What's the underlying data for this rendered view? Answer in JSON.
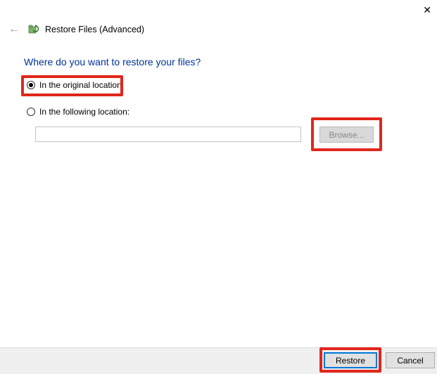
{
  "titlebar": {
    "close": "✕"
  },
  "header": {
    "back": "←",
    "title": "Restore Files (Advanced)"
  },
  "heading": "Where do you want to restore your files?",
  "options": {
    "original": {
      "label": "In the original location",
      "selected": true
    },
    "following": {
      "label": "In the following location:",
      "selected": false
    }
  },
  "location": {
    "value": "",
    "placeholder": ""
  },
  "buttons": {
    "browse": "Browse...",
    "restore": "Restore",
    "cancel": "Cancel"
  },
  "colors": {
    "highlight": "#e1261c",
    "heading": "#003399",
    "primary_border": "#0078d7"
  }
}
